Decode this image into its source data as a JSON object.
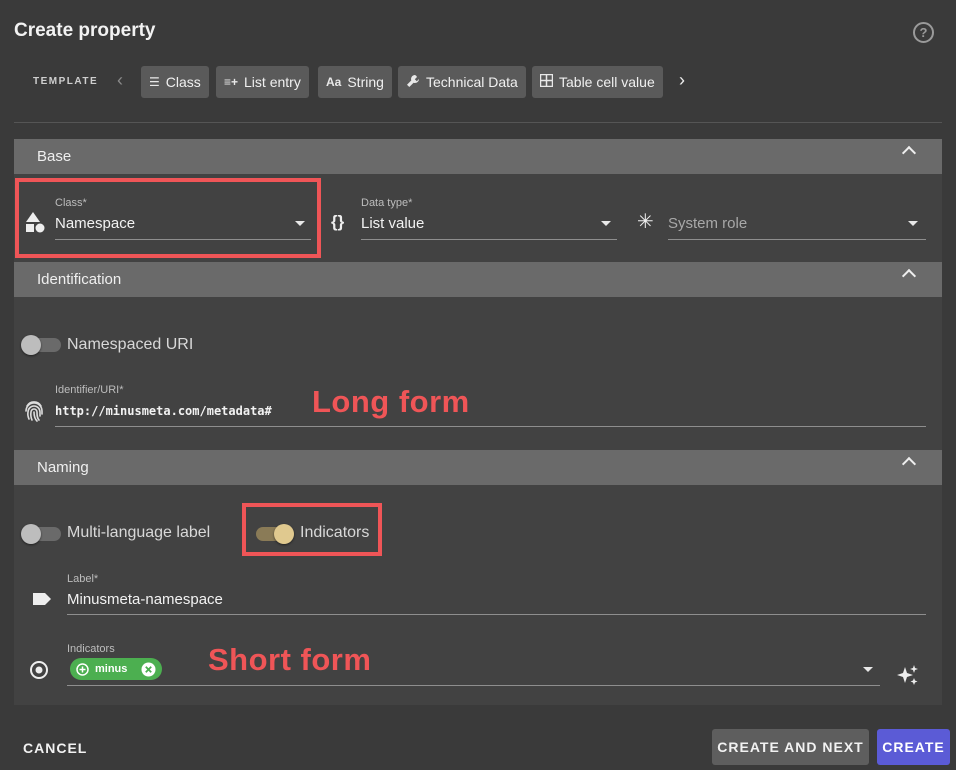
{
  "dialog": {
    "title": "Create property",
    "help_glyph": "?"
  },
  "template": {
    "label": "TEMPLATE",
    "prev_glyph": "‹",
    "next_glyph": "›",
    "chips": [
      {
        "label": "Class",
        "icon": "class-list-icon",
        "glyph": "☰"
      },
      {
        "label": "List entry",
        "icon": "list-add-icon",
        "glyph": "≡+"
      },
      {
        "label": "String",
        "icon": "text-aa-icon",
        "glyph": "Aa"
      },
      {
        "label": "Technical Data",
        "icon": "wrench-icon",
        "glyph": "🔧"
      },
      {
        "label": "Table cell value",
        "icon": "table-icon",
        "glyph": "▦"
      }
    ]
  },
  "base": {
    "header": "Base",
    "class": {
      "label": "Class*",
      "value": "Namespace",
      "icon": "shapes-icon"
    },
    "data_type": {
      "label": "Data type*",
      "value": "List value",
      "icon": "braces-icon",
      "glyph": "{}"
    },
    "system_role": {
      "placeholder": "System role",
      "icon": "asterisk-icon",
      "glyph": "✳"
    }
  },
  "identification": {
    "header": "Identification",
    "namespaced_uri_toggle": {
      "label": "Namespaced URI",
      "on": false
    },
    "identifier": {
      "label": "Identifier/URI*",
      "value": "http://minusmeta.com/metadata#",
      "icon": "fingerprint-icon"
    }
  },
  "naming": {
    "header": "Naming",
    "multi_language_toggle": {
      "label": "Multi-language label",
      "on": false
    },
    "indicators_toggle": {
      "label": "Indicators",
      "on": true
    },
    "label_field": {
      "label": "Label*",
      "value": "Minusmeta-namespace",
      "icon": "tag-icon"
    },
    "indicators_field": {
      "label": "Indicators",
      "chip": "minus",
      "icon": "target-icon",
      "magic_icon": "sparkles-icon"
    }
  },
  "annotations": {
    "long_form": "Long form",
    "short_form": "Short form"
  },
  "footer": {
    "cancel": "CANCEL",
    "create_and_next": "CREATE AND NEXT",
    "create": "CREATE"
  },
  "colors": {
    "background": "#3a3a3a",
    "section_header": "#6a6a6a",
    "highlight_red": "#ef5557",
    "chip_green": "#4caf50",
    "create_button": "#5b5bd6",
    "toggle_on_knob": "#e0c98f"
  }
}
